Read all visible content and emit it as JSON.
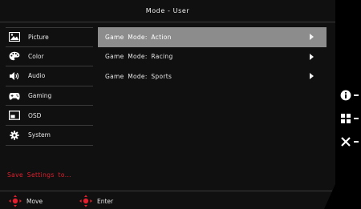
{
  "header": {
    "title": "Mode - User"
  },
  "sidebar": {
    "items": [
      {
        "label": "Picture",
        "icon": "picture-icon"
      },
      {
        "label": "Color",
        "icon": "palette-icon"
      },
      {
        "label": "Audio",
        "icon": "speaker-icon"
      },
      {
        "label": "Gaming",
        "icon": "gamepad-icon"
      },
      {
        "label": "OSD",
        "icon": "osd-icon"
      },
      {
        "label": "System",
        "icon": "gear-icon"
      }
    ]
  },
  "main": {
    "rows": [
      {
        "label": "Game Mode: Action",
        "selected": true
      },
      {
        "label": "Game Mode: Racing",
        "selected": false
      },
      {
        "label": "Game Mode: Sports",
        "selected": false
      }
    ]
  },
  "footer": {
    "save_label": "Save Settings to...",
    "move_label": "Move",
    "enter_label": "Enter"
  },
  "hotkeys": [
    "info-icon",
    "menu-grid-icon",
    "close-icon"
  ],
  "colors": {
    "accent_red": "#e0202e",
    "selection": "#8c8c8c",
    "panel": "#101010"
  }
}
